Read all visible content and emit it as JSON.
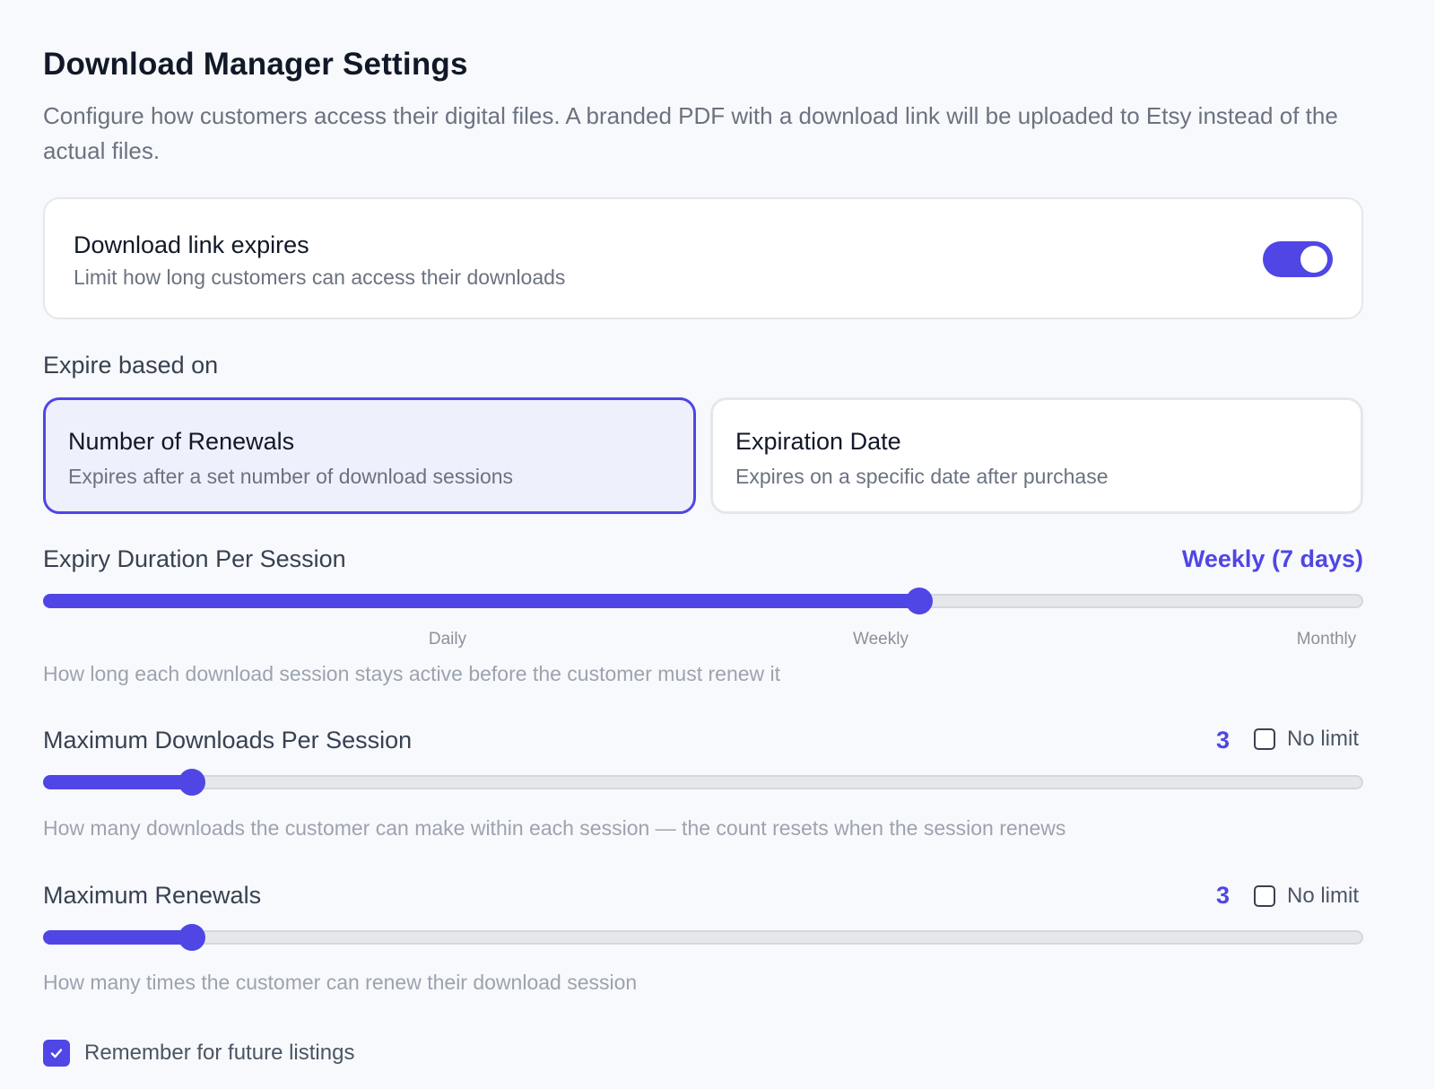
{
  "header": {
    "title": "Download Manager Settings",
    "subtitle": "Configure how customers access their digital files. A branded PDF with a download link will be uploaded to Etsy instead of the actual files."
  },
  "expiry_toggle": {
    "title": "Download link expires",
    "description": "Limit how long customers can access their downloads",
    "enabled": true
  },
  "expire_based_on": {
    "label": "Expire based on",
    "options": [
      {
        "title": "Number of Renewals",
        "description": "Expires after a set number of download sessions",
        "selected": true
      },
      {
        "title": "Expiration Date",
        "description": "Expires on a specific date after purchase",
        "selected": false
      }
    ]
  },
  "expiry_duration": {
    "label": "Expiry Duration Per Session",
    "value_text": "Weekly (7 days)",
    "ticks": [
      "Daily",
      "Weekly",
      "Monthly"
    ],
    "help": "How long each download session stays active before the customer must renew it"
  },
  "max_downloads": {
    "label": "Maximum Downloads Per Session",
    "value": "3",
    "no_limit_label": "No limit",
    "no_limit_checked": false,
    "help": "How many downloads the customer can make within each session — the count resets when the session renews"
  },
  "max_renewals": {
    "label": "Maximum Renewals",
    "value": "3",
    "no_limit_label": "No limit",
    "no_limit_checked": false,
    "help": "How many times the customer can renew their download session"
  },
  "remember": {
    "label": "Remember for future listings",
    "checked": true
  },
  "colors": {
    "accent": "#4f46e5",
    "background": "#f8f9fc",
    "card_border": "#e5e7eb",
    "selected_card_bg": "#eef0fb",
    "muted_text": "#6b7280",
    "help_text": "#9ca3af"
  },
  "icons": {
    "remember_checkbox": "check-icon"
  }
}
